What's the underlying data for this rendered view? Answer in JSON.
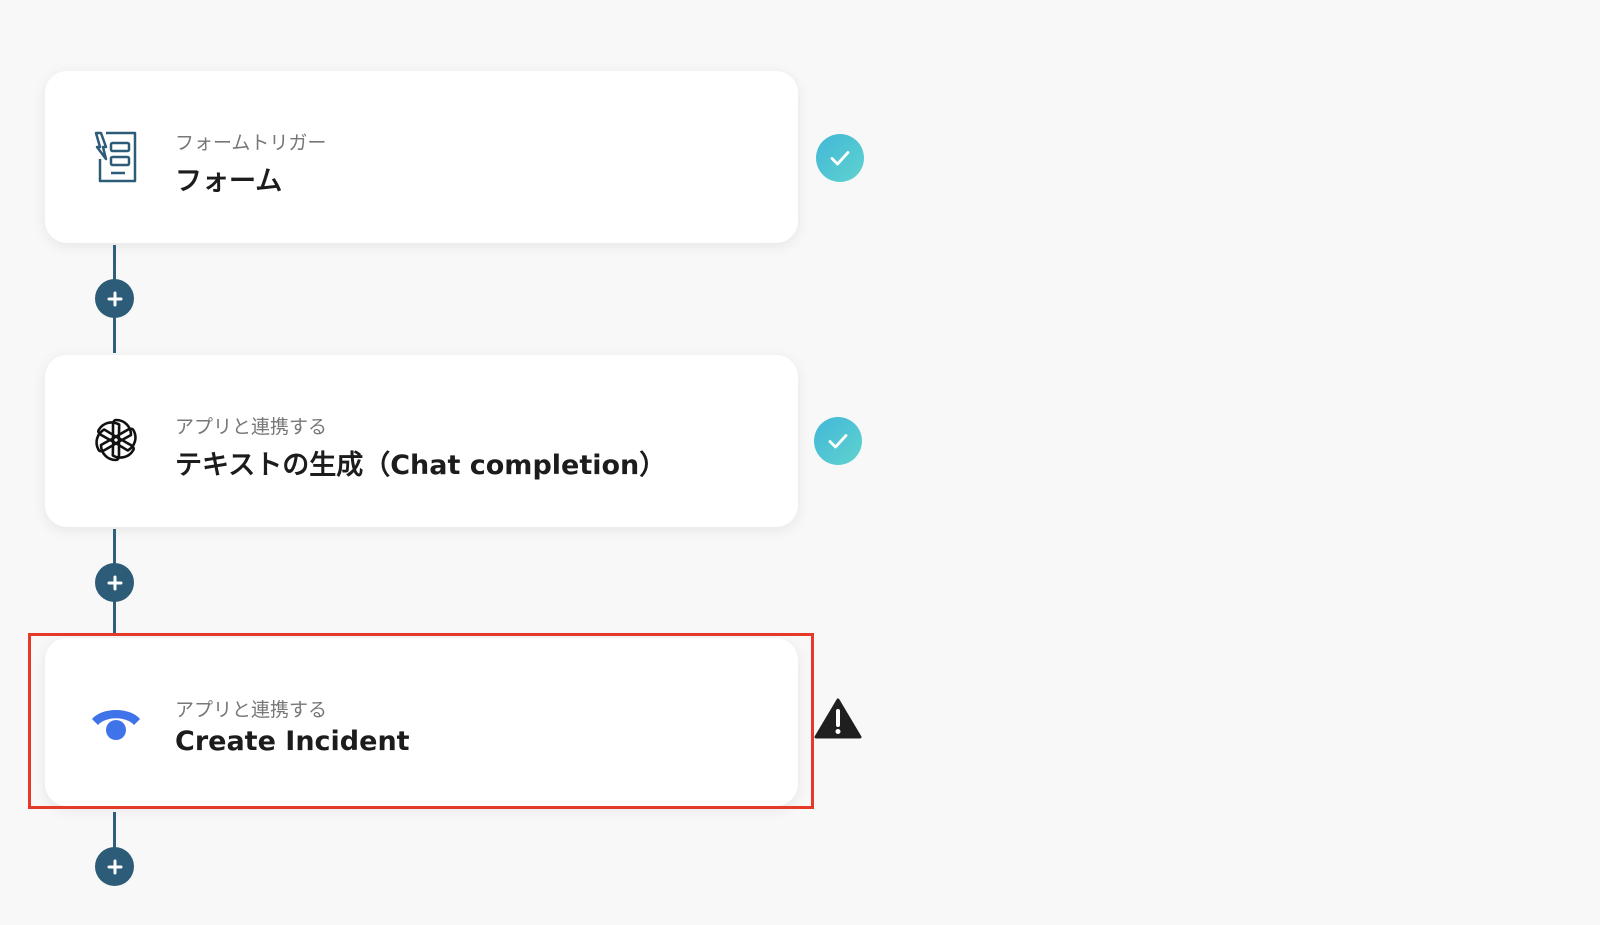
{
  "steps": [
    {
      "subtitle": "フォームトリガー",
      "title": "フォーム",
      "icon": "form-trigger-icon",
      "status": "complete"
    },
    {
      "subtitle": "アプリと連携する",
      "title": "テキストの生成（Chat completion）",
      "icon": "openai-icon",
      "status": "complete"
    },
    {
      "subtitle": "アプリと連携する",
      "title": "Create Incident",
      "icon": "statuspage-icon",
      "status": "warning",
      "highlighted": true
    }
  ],
  "colors": {
    "background": "#f8f8f8",
    "connector": "#2f5f7a",
    "add_button": "#2c5c77",
    "check_gradient_start": "#42b7d7",
    "check_gradient_end": "#5fd3cf",
    "highlight_border": "#e53929",
    "warning": "#1f1f1f",
    "statuspage_blue": "#3f73ea"
  }
}
